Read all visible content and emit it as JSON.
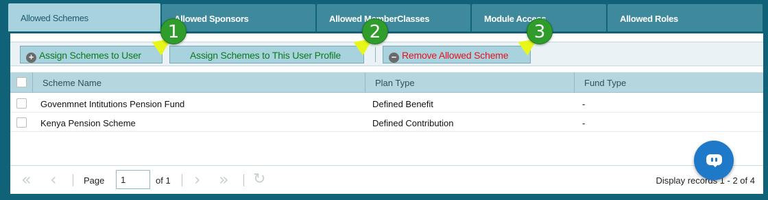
{
  "tabs": [
    {
      "label": "Allowed Schemes",
      "active": true
    },
    {
      "label": "Allowed Sponsors",
      "active": false
    },
    {
      "label": "Allowed MemberClasses",
      "active": false
    },
    {
      "label": "Module Access",
      "active": false
    },
    {
      "label": "Allowed Roles",
      "active": false
    }
  ],
  "toolbar": {
    "assign_user_label": "Assign Schemes to User",
    "assign_profile_label": "Assign Schemes to This User Profile",
    "remove_label": "Remove Allowed Scheme"
  },
  "grid": {
    "columns": [
      "Scheme Name",
      "Plan Type",
      "Fund Type"
    ],
    "rows": [
      {
        "scheme_name": "Govenmnet Intitutions Pension Fund",
        "plan_type": "Defined Benefit",
        "fund_type": "-"
      },
      {
        "scheme_name": "Kenya Pension Scheme",
        "plan_type": "Defined Contribution",
        "fund_type": "-"
      }
    ]
  },
  "pager": {
    "page_label": "Page",
    "page_value": "1",
    "of_label": "of 1",
    "display_text": "Display records 1 - 2 of 4"
  },
  "annotations": [
    "1",
    "2",
    "3"
  ],
  "colors": {
    "tab_bar": "#0f6277",
    "active_tab": "#a7d2de",
    "button_text": "#0b7a1a",
    "remove_text": "#e8101a",
    "badge": "#2f9c2b",
    "callout": "#e8f71a",
    "chat": "#1e79c8"
  },
  "icons": {
    "assign": "plus-circle-icon",
    "remove": "minus-circle-icon",
    "first": "first-page-icon",
    "prev": "prev-page-icon",
    "next": "next-page-icon",
    "last": "last-page-icon",
    "refresh": "refresh-icon",
    "chat": "chat-bot-icon"
  }
}
